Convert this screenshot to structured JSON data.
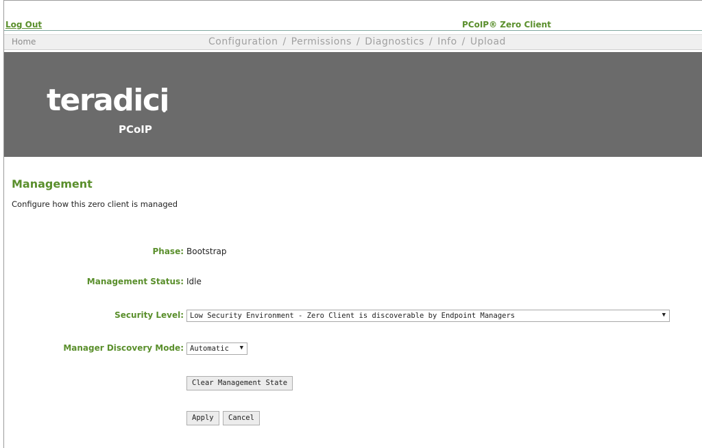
{
  "topbar": {
    "logout_label": "Log Out",
    "device_title": "PCoIP® Zero Client"
  },
  "nav": {
    "home": "Home",
    "links": [
      "Configuration",
      "Permissions",
      "Diagnostics",
      "Info",
      "Upload"
    ],
    "separator": "/"
  },
  "banner": {
    "brand": "teradici",
    "sub": "PCoIP"
  },
  "page": {
    "title": "Management",
    "description": "Configure how this zero client is managed"
  },
  "fields": {
    "phase": {
      "label": "Phase:",
      "value": "Bootstrap"
    },
    "status": {
      "label": "Management Status:",
      "value": "Idle"
    },
    "security": {
      "label": "Security Level:",
      "selected": "Low Security Environment - Zero Client is discoverable by Endpoint Managers",
      "arrow": "▼"
    },
    "discovery": {
      "label": "Manager Discovery Mode:",
      "selected": "Automatic",
      "arrow": "▼"
    }
  },
  "buttons": {
    "clear": "Clear Management State",
    "apply": "Apply",
    "cancel": "Cancel"
  },
  "colors": {
    "accent": "#5a8f2c",
    "banner": "#6b6b6b"
  }
}
